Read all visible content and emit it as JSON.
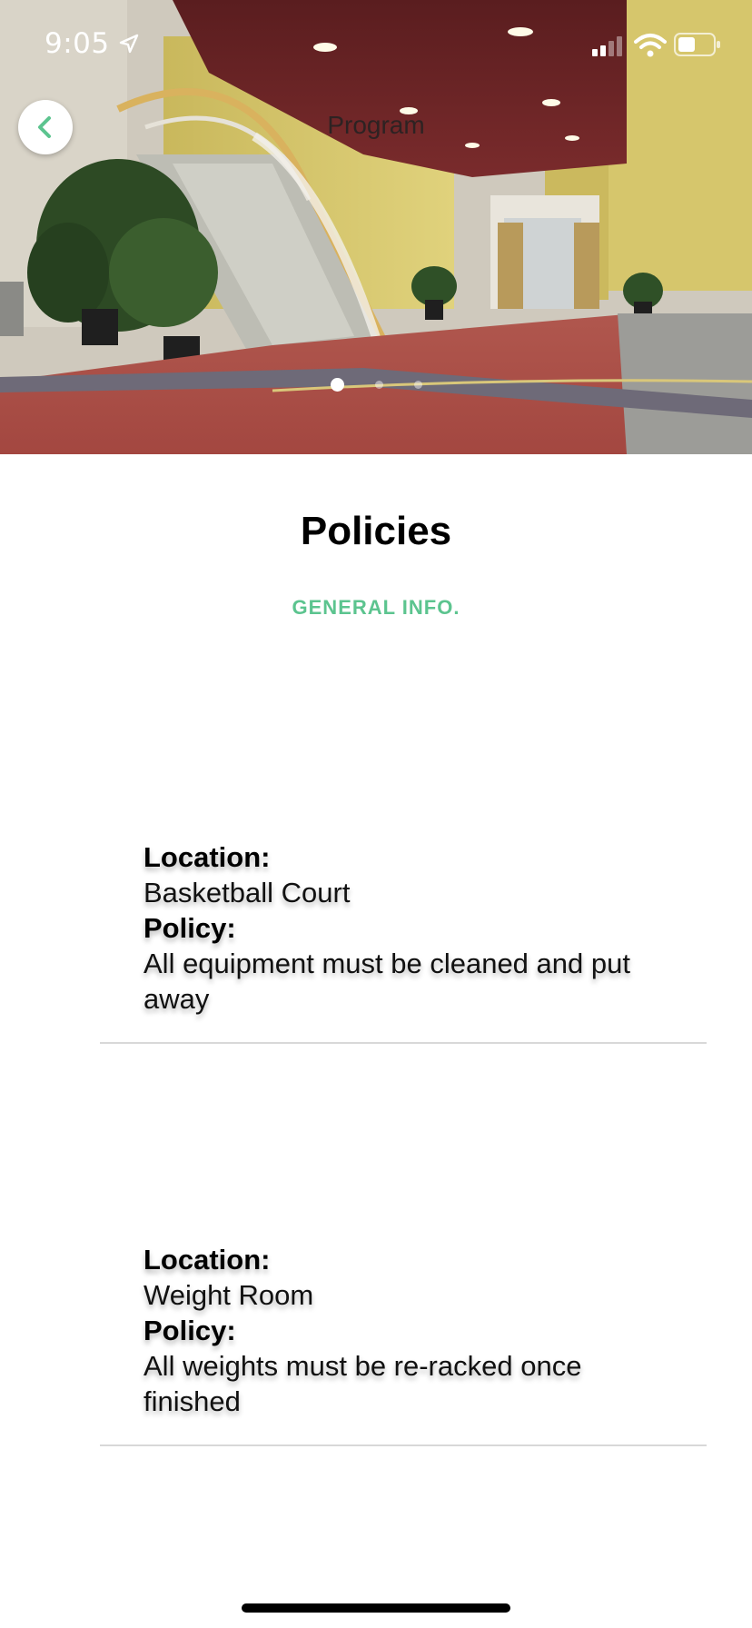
{
  "status_bar": {
    "time": "9:05"
  },
  "nav": {
    "title": "Program",
    "back_icon": "chevron-left-icon"
  },
  "carousel": {
    "page_count": 3,
    "active_index": 0
  },
  "section": {
    "title": "Policies",
    "subtitle": "GENERAL INFO."
  },
  "policies": [
    {
      "location_label": "Location:",
      "location": "Basketball Court",
      "policy_label": "Policy:",
      "policy": "All equipment must be cleaned and put away"
    },
    {
      "location_label": "Location:",
      "location": "Weight Room",
      "policy_label": "Policy:",
      "policy": "All weights must be re-racked once finished"
    }
  ],
  "colors": {
    "accent": "#5cc48f",
    "back_chevron": "#5cc48f"
  }
}
